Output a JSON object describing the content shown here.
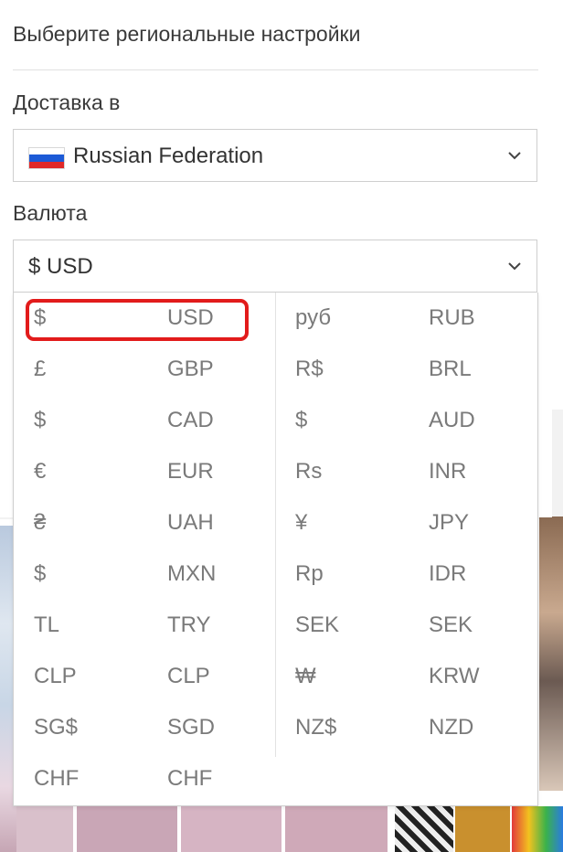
{
  "panel": {
    "title": "Выберите региональные настройки",
    "shipping_label": "Доставка в",
    "country": {
      "value": "Russian Federation",
      "flag": "russia-flag",
      "flag_colors": [
        "#ffffff",
        "#1c5ad6",
        "#e02828"
      ]
    },
    "currency_label": "Валюта",
    "currency": {
      "value": "$ USD"
    }
  },
  "currency_options": [
    {
      "symbol": "$",
      "code": "USD"
    },
    {
      "symbol": "£",
      "code": "GBP"
    },
    {
      "symbol": "$",
      "code": "CAD"
    },
    {
      "symbol": "€",
      "code": "EUR"
    },
    {
      "symbol": "₴",
      "code": "UAH"
    },
    {
      "symbol": "$",
      "code": "MXN"
    },
    {
      "symbol": "TL",
      "code": "TRY"
    },
    {
      "symbol": "CLP",
      "code": "CLP"
    },
    {
      "symbol": "SG$",
      "code": "SGD"
    },
    {
      "symbol": "CHF",
      "code": "CHF"
    },
    {
      "symbol": "руб",
      "code": "RUB"
    },
    {
      "symbol": "R$",
      "code": "BRL"
    },
    {
      "symbol": "$",
      "code": "AUD"
    },
    {
      "symbol": "Rs",
      "code": "INR"
    },
    {
      "symbol": "¥",
      "code": "JPY"
    },
    {
      "symbol": "Rp",
      "code": "IDR"
    },
    {
      "symbol": "SEK",
      "code": "SEK"
    },
    {
      "symbol": "₩",
      "code": "KRW"
    },
    {
      "symbol": "NZ$",
      "code": "NZD"
    }
  ],
  "highlighted_option": "USD",
  "colors": {
    "highlight": "#e21b1b",
    "option_text": "#7a7a7a",
    "border": "#cfcfcf"
  }
}
